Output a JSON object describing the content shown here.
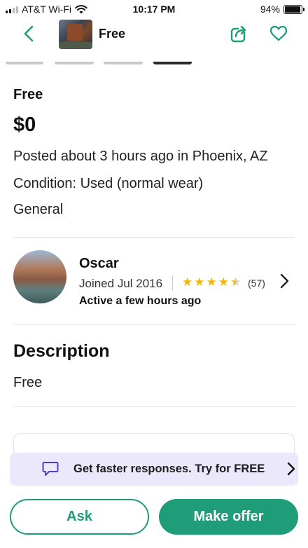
{
  "status_bar": {
    "carrier": "AT&T Wi-Fi",
    "time": "10:17 PM",
    "battery": "94%",
    "battery_level": 0.94
  },
  "header": {
    "title": "Free",
    "back_icon": "chevron-left-icon",
    "share_icon": "share-icon",
    "favorite_icon": "heart-icon"
  },
  "listing": {
    "title": "Free",
    "price": "$0",
    "posted": "Posted about 3 hours ago in Phoenix, AZ",
    "condition": "Condition: Used (normal wear)",
    "category": "General"
  },
  "seller": {
    "name": "Oscar",
    "joined": "Joined Jul 2016",
    "rating": 4.5,
    "rating_count": "(57)",
    "activity": "Active a few hours ago"
  },
  "description": {
    "heading": "Description",
    "text": "Free"
  },
  "promo": {
    "text": "Get faster responses. Try for FREE"
  },
  "actions": {
    "ask_label": "Ask",
    "offer_label": "Make offer"
  },
  "colors": {
    "accent": "#1f9c78",
    "promo_bg": "#ebe8fb",
    "star": "#f2b705"
  }
}
